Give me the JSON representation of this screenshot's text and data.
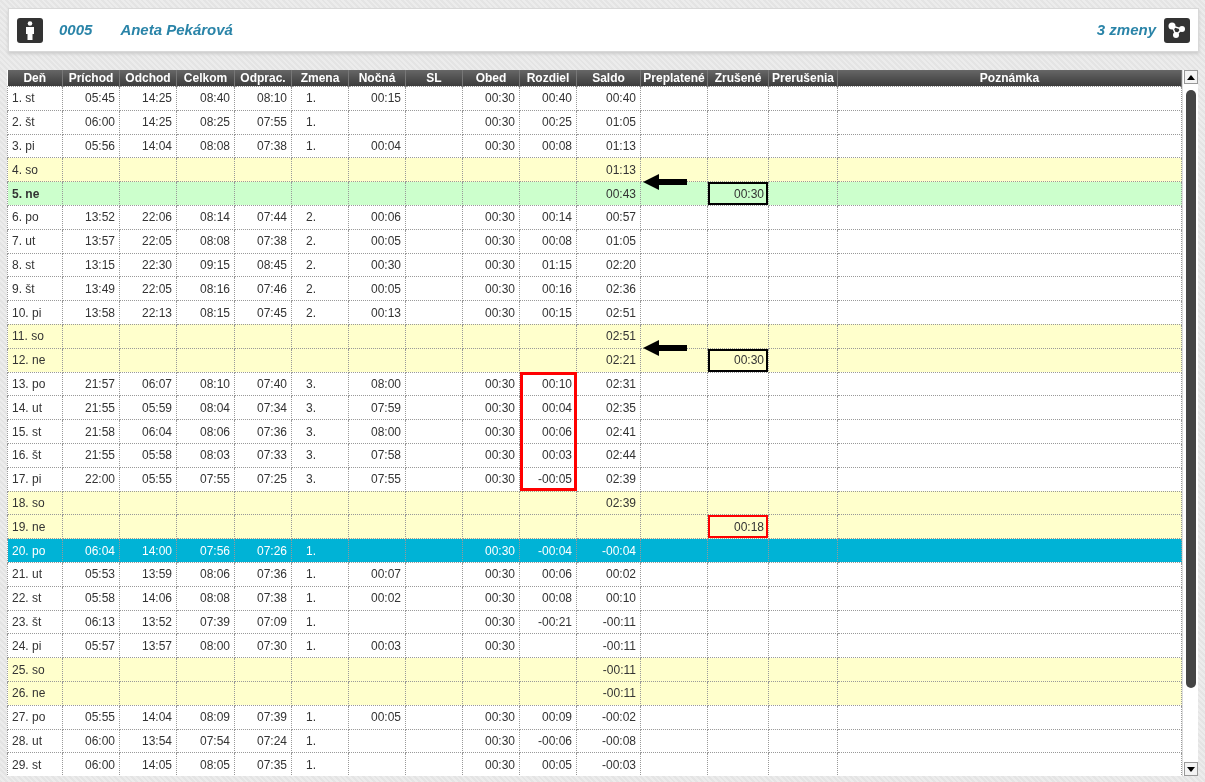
{
  "header": {
    "employee_id": "0005",
    "employee_name": "Aneta Pekárová",
    "shift_label": "3 zmeny"
  },
  "table": {
    "columns": [
      "Deň",
      "Príchod",
      "Odchod",
      "Celkom",
      "Odprac.",
      "Zmena",
      "Nočná",
      "SL",
      "Obed",
      "Rozdiel",
      "Saldo",
      "Preplatené",
      "Zrušené",
      "Prerušenia",
      "Poznámka"
    ],
    "rows": [
      {
        "kind": "workday",
        "selected": false,
        "den": "1. st",
        "prichod": "05:45",
        "odchod": "14:25",
        "celkom": "08:40",
        "odprac": "08:10",
        "zmena": "1.",
        "nocna": "00:15",
        "obed": "00:30",
        "rozdiel": "00:40",
        "saldo": "00:40"
      },
      {
        "kind": "workday",
        "selected": false,
        "den": "2. št",
        "prichod": "06:00",
        "odchod": "14:25",
        "celkom": "08:25",
        "odprac": "07:55",
        "zmena": "1.",
        "obed": "00:30",
        "rozdiel": "00:25",
        "saldo": "01:05"
      },
      {
        "kind": "workday",
        "selected": false,
        "den": "3. pi",
        "prichod": "05:56",
        "odchod": "14:04",
        "celkom": "08:08",
        "odprac": "07:38",
        "zmena": "1.",
        "nocna": "00:04",
        "obed": "00:30",
        "rozdiel": "00:08",
        "saldo": "01:13"
      },
      {
        "kind": "weekend",
        "selected": false,
        "den": "4. so",
        "saldo": "01:13",
        "arrow": true
      },
      {
        "kind": "holiday",
        "selected": false,
        "den": "5. ne",
        "saldo": "00:43",
        "zrusene": {
          "text": "00:30",
          "color": "#000000"
        }
      },
      {
        "kind": "workday",
        "selected": false,
        "den": "6. po",
        "prichod": "13:52",
        "odchod": "22:06",
        "celkom": "08:14",
        "odprac": "07:44",
        "zmena": "2.",
        "nocna": "00:06",
        "obed": "00:30",
        "rozdiel": "00:14",
        "saldo": "00:57"
      },
      {
        "kind": "workday",
        "selected": false,
        "den": "7. ut",
        "prichod": "13:57",
        "odchod": "22:05",
        "celkom": "08:08",
        "odprac": "07:38",
        "zmena": "2.",
        "nocna": "00:05",
        "obed": "00:30",
        "rozdiel": "00:08",
        "saldo": "01:05"
      },
      {
        "kind": "workday",
        "selected": false,
        "den": "8. st",
        "prichod": "13:15",
        "odchod": "22:30",
        "celkom": "09:15",
        "odprac": "08:45",
        "zmena": "2.",
        "nocna": "00:30",
        "obed": "00:30",
        "rozdiel": "01:15",
        "saldo": "02:20"
      },
      {
        "kind": "workday",
        "selected": false,
        "den": "9. št",
        "prichod": "13:49",
        "odchod": "22:05",
        "celkom": "08:16",
        "odprac": "07:46",
        "zmena": "2.",
        "nocna": "00:05",
        "obed": "00:30",
        "rozdiel": "00:16",
        "saldo": "02:36"
      },
      {
        "kind": "workday",
        "selected": false,
        "den": "10. pi",
        "prichod": "13:58",
        "odchod": "22:13",
        "celkom": "08:15",
        "odprac": "07:45",
        "zmena": "2.",
        "nocna": "00:13",
        "obed": "00:30",
        "rozdiel": "00:15",
        "saldo": "02:51"
      },
      {
        "kind": "weekend",
        "selected": false,
        "den": "11. so",
        "saldo": "02:51",
        "arrow": true
      },
      {
        "kind": "weekend",
        "selected": false,
        "den": "12. ne",
        "saldo": "02:21",
        "zrusene": {
          "text": "00:30",
          "color": "#000000"
        }
      },
      {
        "kind": "workday",
        "selected": false,
        "den": "13. po",
        "prichod": "21:57",
        "odchod": "06:07",
        "celkom": "08:10",
        "odprac": "07:40",
        "zmena": "3.",
        "nocna": "08:00",
        "obed": "00:30",
        "rozdiel": {
          "text": "00:10",
          "color": "#ff0000"
        },
        "saldo": "02:31"
      },
      {
        "kind": "workday",
        "selected": false,
        "den": "14. ut",
        "prichod": "21:55",
        "odchod": "05:59",
        "celkom": "08:04",
        "odprac": "07:34",
        "zmena": "3.",
        "nocna": "07:59",
        "obed": "00:30",
        "rozdiel": {
          "text": "00:04",
          "color": "#ff0000"
        },
        "saldo": "02:35"
      },
      {
        "kind": "workday",
        "selected": false,
        "den": "15. st",
        "prichod": "21:58",
        "odchod": "06:04",
        "celkom": "08:06",
        "odprac": "07:36",
        "zmena": "3.",
        "nocna": "08:00",
        "obed": "00:30",
        "rozdiel": {
          "text": "00:06",
          "color": "#ff0000"
        },
        "saldo": "02:41"
      },
      {
        "kind": "workday",
        "selected": false,
        "den": "16. št",
        "prichod": "21:55",
        "odchod": "05:58",
        "celkom": "08:03",
        "odprac": "07:33",
        "zmena": "3.",
        "nocna": "07:58",
        "obed": "00:30",
        "rozdiel": {
          "text": "00:03",
          "color": "#ff0000"
        },
        "saldo": "02:44"
      },
      {
        "kind": "workday",
        "selected": false,
        "den": "17. pi",
        "prichod": "22:00",
        "odchod": "05:55",
        "celkom": "07:55",
        "odprac": "07:25",
        "zmena": "3.",
        "nocna": "07:55",
        "obed": "00:30",
        "rozdiel": {
          "text": "-00:05",
          "color": "#ff0000"
        },
        "saldo": "02:39"
      },
      {
        "kind": "weekend",
        "selected": false,
        "den": "18. so",
        "saldo": "02:39"
      },
      {
        "kind": "weekend",
        "selected": false,
        "den": "19. ne",
        "zrusene": {
          "text": "00:18",
          "color": "#ff0000"
        }
      },
      {
        "kind": "workday",
        "selected": true,
        "den": "20. po",
        "prichod": "06:04",
        "odchod": "14:00",
        "celkom": "07:56",
        "odprac": "07:26",
        "zmena": "1.",
        "obed": "00:30",
        "rozdiel": "-00:04",
        "saldo": "-00:04"
      },
      {
        "kind": "workday",
        "selected": false,
        "den": "21. ut",
        "prichod": "05:53",
        "odchod": "13:59",
        "celkom": "08:06",
        "odprac": "07:36",
        "zmena": "1.",
        "nocna": "00:07",
        "obed": "00:30",
        "rozdiel": "00:06",
        "saldo": "00:02"
      },
      {
        "kind": "workday",
        "selected": false,
        "den": "22. st",
        "prichod": "05:58",
        "odchod": "14:06",
        "celkom": "08:08",
        "odprac": "07:38",
        "zmena": "1.",
        "nocna": "00:02",
        "obed": "00:30",
        "rozdiel": "00:08",
        "saldo": "00:10"
      },
      {
        "kind": "workday",
        "selected": false,
        "den": "23. št",
        "prichod": "06:13",
        "odchod": "13:52",
        "celkom": "07:39",
        "odprac": "07:09",
        "zmena": "1.",
        "obed": "00:30",
        "rozdiel": "-00:21",
        "saldo": "-00:11"
      },
      {
        "kind": "workday",
        "selected": false,
        "den": "24. pi",
        "prichod": "05:57",
        "odchod": "13:57",
        "celkom": "08:00",
        "odprac": "07:30",
        "zmena": "1.",
        "nocna": "00:03",
        "obed": "00:30",
        "saldo": "-00:11"
      },
      {
        "kind": "weekend",
        "selected": false,
        "den": "25. so",
        "saldo": "-00:11"
      },
      {
        "kind": "weekend",
        "selected": false,
        "den": "26. ne",
        "saldo": "-00:11"
      },
      {
        "kind": "workday",
        "selected": false,
        "den": "27. po",
        "prichod": "05:55",
        "odchod": "14:04",
        "celkom": "08:09",
        "odprac": "07:39",
        "zmena": "1.",
        "nocna": "00:05",
        "obed": "00:30",
        "rozdiel": "00:09",
        "saldo": "-00:02"
      },
      {
        "kind": "workday",
        "selected": false,
        "den": "28. ut",
        "prichod": "06:00",
        "odchod": "13:54",
        "celkom": "07:54",
        "odprac": "07:24",
        "zmena": "1.",
        "obed": "00:30",
        "rozdiel": "-00:06",
        "saldo": "-00:08"
      },
      {
        "kind": "workday",
        "selected": false,
        "den": "29. st",
        "prichod": "06:00",
        "odchod": "14:05",
        "celkom": "08:05",
        "odprac": "07:35",
        "zmena": "1.",
        "obed": "00:30",
        "rozdiel": "00:05",
        "saldo": "-00:03"
      }
    ]
  }
}
